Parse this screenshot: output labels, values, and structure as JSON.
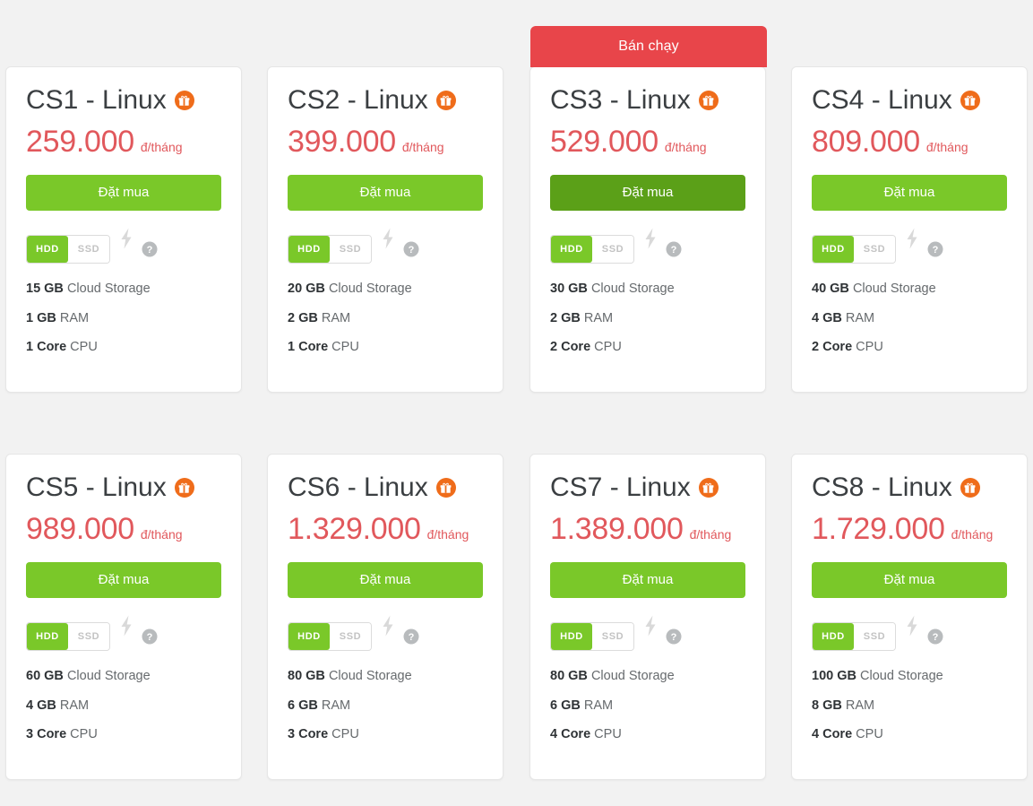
{
  "page": {
    "background_color": "#f2f2f2",
    "currency_unit": "đ/tháng",
    "buy_label": "Đặt mua",
    "featured_badge_label": "Bán chạy",
    "storage_option_primary": "HDD",
    "storage_option_secondary": "SSD",
    "colors": {
      "accent_green": "#7ac829",
      "accent_green_dark": "#5ba018",
      "price_red": "#e1585c",
      "badge_red": "#e8454a",
      "gift_orange": "#ef6c1a",
      "spec_label": "#2f3336",
      "spec_text": "#666a6d"
    }
  },
  "plans": [
    {
      "id": "cs1",
      "title": "CS1 - Linux",
      "gift_icon": "gift-icon",
      "price": "259.000",
      "unit": "đ/tháng",
      "buy_label": "Đặt mua",
      "featured": false,
      "badge": "",
      "storage_active": "HDD",
      "storage_inactive": "SSD",
      "specs": [
        {
          "value": "15 GB",
          "label": "Cloud Storage"
        },
        {
          "value": "1 GB",
          "label": "RAM"
        },
        {
          "value": "1 Core",
          "label": "CPU"
        }
      ]
    },
    {
      "id": "cs2",
      "title": "CS2 - Linux",
      "gift_icon": "gift-icon",
      "price": "399.000",
      "unit": "đ/tháng",
      "buy_label": "Đặt mua",
      "featured": false,
      "badge": "",
      "storage_active": "HDD",
      "storage_inactive": "SSD",
      "specs": [
        {
          "value": "20 GB",
          "label": "Cloud Storage"
        },
        {
          "value": "2 GB",
          "label": "RAM"
        },
        {
          "value": "1 Core",
          "label": "CPU"
        }
      ]
    },
    {
      "id": "cs3",
      "title": "CS3 - Linux",
      "gift_icon": "gift-icon",
      "price": "529.000",
      "unit": "đ/tháng",
      "buy_label": "Đặt mua",
      "featured": true,
      "badge": "Bán chạy",
      "storage_active": "HDD",
      "storage_inactive": "SSD",
      "specs": [
        {
          "value": "30 GB",
          "label": "Cloud Storage"
        },
        {
          "value": "2 GB",
          "label": "RAM"
        },
        {
          "value": "2 Core",
          "label": "CPU"
        }
      ]
    },
    {
      "id": "cs4",
      "title": "CS4 - Linux",
      "gift_icon": "gift-icon",
      "price": "809.000",
      "unit": "đ/tháng",
      "buy_label": "Đặt mua",
      "featured": false,
      "badge": "",
      "storage_active": "HDD",
      "storage_inactive": "SSD",
      "specs": [
        {
          "value": "40 GB",
          "label": "Cloud Storage"
        },
        {
          "value": "4 GB",
          "label": "RAM"
        },
        {
          "value": "2 Core",
          "label": "CPU"
        }
      ]
    },
    {
      "id": "cs5",
      "title": "CS5 - Linux",
      "gift_icon": "gift-icon",
      "price": "989.000",
      "unit": "đ/tháng",
      "buy_label": "Đặt mua",
      "featured": false,
      "badge": "",
      "storage_active": "HDD",
      "storage_inactive": "SSD",
      "specs": [
        {
          "value": "60 GB",
          "label": "Cloud Storage"
        },
        {
          "value": "4 GB",
          "label": "RAM"
        },
        {
          "value": "3 Core",
          "label": "CPU"
        }
      ]
    },
    {
      "id": "cs6",
      "title": "CS6 - Linux",
      "gift_icon": "gift-icon",
      "price": "1.329.000",
      "unit": "đ/tháng",
      "buy_label": "Đặt mua",
      "featured": false,
      "badge": "",
      "storage_active": "HDD",
      "storage_inactive": "SSD",
      "specs": [
        {
          "value": "80 GB",
          "label": "Cloud Storage"
        },
        {
          "value": "6 GB",
          "label": "RAM"
        },
        {
          "value": "3 Core",
          "label": "CPU"
        }
      ]
    },
    {
      "id": "cs7",
      "title": "CS7 - Linux",
      "gift_icon": "gift-icon",
      "price": "1.389.000",
      "unit": "đ/tháng",
      "buy_label": "Đặt mua",
      "featured": false,
      "badge": "",
      "storage_active": "HDD",
      "storage_inactive": "SSD",
      "specs": [
        {
          "value": "80 GB",
          "label": "Cloud Storage"
        },
        {
          "value": "6 GB",
          "label": "RAM"
        },
        {
          "value": "4 Core",
          "label": "CPU"
        }
      ]
    },
    {
      "id": "cs8",
      "title": "CS8 - Linux",
      "gift_icon": "gift-icon",
      "price": "1.729.000",
      "unit": "đ/tháng",
      "buy_label": "Đặt mua",
      "featured": false,
      "badge": "",
      "storage_active": "HDD",
      "storage_inactive": "SSD",
      "specs": [
        {
          "value": "100 GB",
          "label": "Cloud Storage"
        },
        {
          "value": "8 GB",
          "label": "RAM"
        },
        {
          "value": "4 Core",
          "label": "CPU"
        }
      ]
    }
  ]
}
